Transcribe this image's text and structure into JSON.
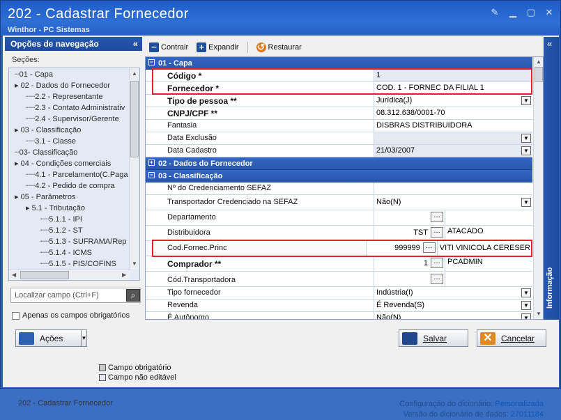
{
  "window": {
    "title": "202 - Cadastrar  Fornecedor",
    "subtitle": "Winthor - PC Sistemas"
  },
  "nav": {
    "header": "Opções de navegação",
    "sections_label": "Seções:",
    "tree": [
      "01 - Capa",
      "02 - Dados do Fornecedor",
      "2.2 - Representante",
      "2.3 - Contato Administrativ",
      "2.4 - Supervisor/Gerente",
      "03 - Classificação",
      "3.1 - Classe",
      "03- Classificação",
      "04 - Condições comerciais",
      "4.1 - Parcelamento(C.Paga",
      "4.2 - Pedido de compra",
      "05 - Parâmetros",
      "5.1 - Tributação",
      "5.1.1 - IPI",
      "5.1.2 - ST",
      "5.1.3 - SUFRAMA/Rep",
      "5.1.4 - ICMS",
      "5.1.5 - PIS/COFINS"
    ],
    "locate_placeholder": "Localizar campo (Ctrl+F)",
    "only_required": "Apenas os campos obrigatórios"
  },
  "toolbar": {
    "collapse": "Contrair",
    "expand": "Expandir",
    "restore": "Restaurar"
  },
  "grid": {
    "sec1": "01 - Capa",
    "sec2": "02 - Dados do Fornecedor",
    "sec3": "03 - Classificação",
    "rows": [
      {
        "label": "Código *",
        "value": "1"
      },
      {
        "label": "Fornecedor *",
        "value": "COD. 1 - FORNEC DA FILIAL 1"
      },
      {
        "label": "Tipo de pessoa **",
        "value": "Jurídica(J)"
      },
      {
        "label": "CNPJ/CPF **",
        "value": "08.312.638/0001-70"
      },
      {
        "label": "Fantasia",
        "value": "DISBRAS DISTRIBUIDORA"
      },
      {
        "label": "Data Exclusão",
        "value": ""
      },
      {
        "label": "Data Cadastro",
        "value": "21/03/2007"
      },
      {
        "label": "Nº do Credenciamento SEFAZ",
        "value": ""
      },
      {
        "label": "Transportador Credenciado na SEFAZ",
        "value": "Não(N)"
      },
      {
        "label": "Departamento",
        "value": "",
        "desc": ""
      },
      {
        "label": "Distribuidora",
        "value": "TST",
        "desc": "ATACADO"
      },
      {
        "label": "Cod.Fornec.Princ",
        "value": "999999",
        "desc": "VITI VINICOLA CERESER"
      },
      {
        "label": "Comprador **",
        "value": "1",
        "desc": "PCADMIN"
      },
      {
        "label": "Cód.Transportadora",
        "value": "",
        "desc": ""
      },
      {
        "label": "Tipo fornecedor",
        "value": "Indústria(I)"
      },
      {
        "label": "Revenda",
        "value": "É Revenda(S)"
      },
      {
        "label": "É Autônomo",
        "value": "Não(N)"
      }
    ]
  },
  "info_label": "Informação",
  "actions": "Ações",
  "legend": {
    "required": "Campo obrigatório",
    "noneditable": "Campo não editável"
  },
  "save": "Salvar",
  "cancel": "Cancelar",
  "footer": {
    "left": "202 - Cadastrar  Fornecedor",
    "dict_config_label": "Configuração do dicionário:",
    "dict_config": "Personalizada",
    "dict_version_label": "Versão do dicionário de dados:",
    "dict_version": "27011184"
  },
  "colors": {
    "highlight": "#e0202a",
    "section": "#2a57ad"
  }
}
